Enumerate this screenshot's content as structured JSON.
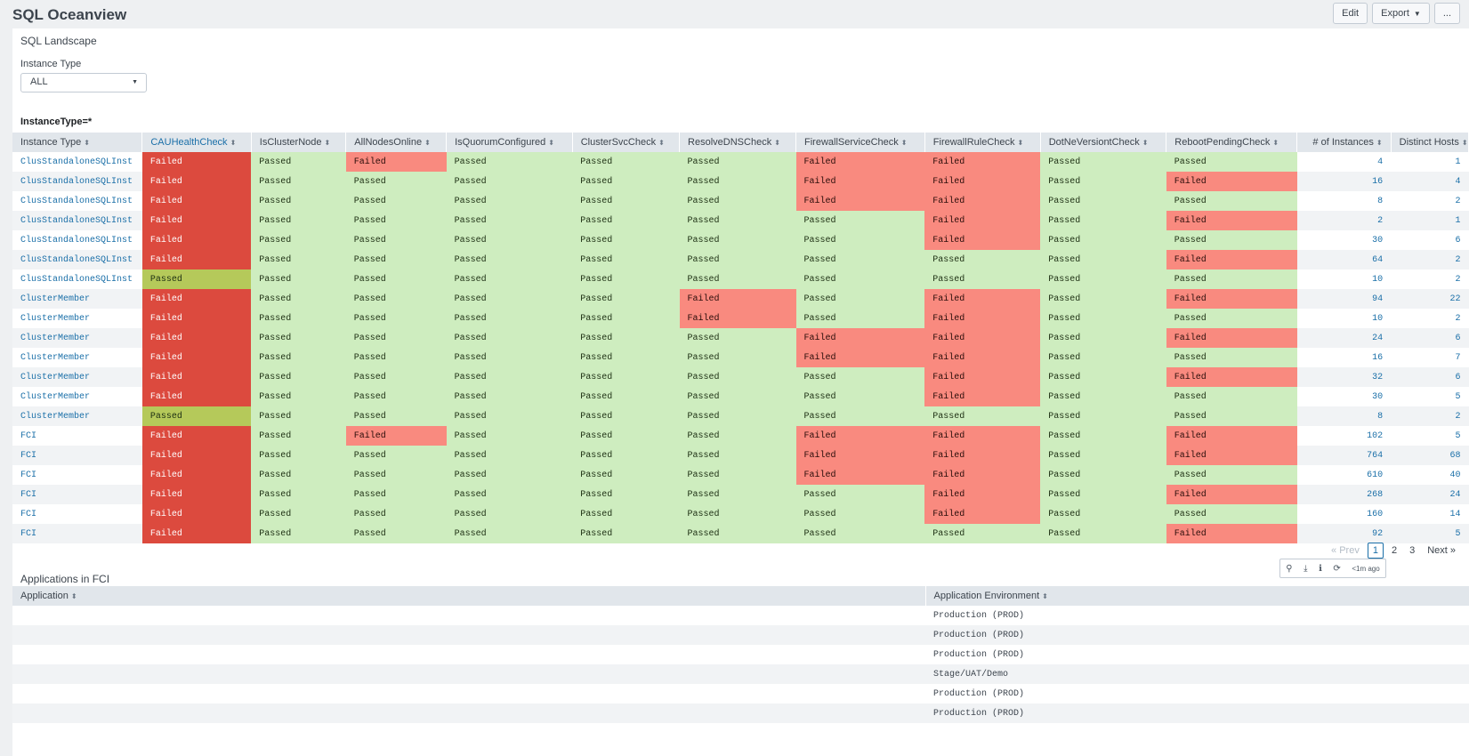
{
  "header": {
    "title": "SQL Oceanview",
    "edit_label": "Edit",
    "export_label": "Export",
    "more_label": "..."
  },
  "panel1": {
    "title": "SQL Landscape",
    "input_label": "Instance Type",
    "input_value": "ALL",
    "search_label": "InstanceType=*"
  },
  "main_table": {
    "columns": [
      "Instance Type",
      "CAUHealthCheck",
      "IsClusterNode",
      "AllNodesOnline",
      "IsQuorumConfigured",
      "ClusterSvcCheck",
      "ResolveDNSCheck",
      "FirewallServiceCheck",
      "FirewallRuleCheck",
      "DotNeVersiontCheck",
      "RebootPendingCheck",
      "# of Instances",
      "Distinct Hosts"
    ],
    "rows": [
      [
        "ClusStandaloneSQLInst",
        "Failed",
        "Passed",
        "Failed",
        "Passed",
        "Passed",
        "Passed",
        "Failed",
        "Failed",
        "Passed",
        "Passed",
        "4",
        "1"
      ],
      [
        "ClusStandaloneSQLInst",
        "Failed",
        "Passed",
        "Passed",
        "Passed",
        "Passed",
        "Passed",
        "Failed",
        "Failed",
        "Passed",
        "Failed",
        "16",
        "4"
      ],
      [
        "ClusStandaloneSQLInst",
        "Failed",
        "Passed",
        "Passed",
        "Passed",
        "Passed",
        "Passed",
        "Failed",
        "Failed",
        "Passed",
        "Passed",
        "8",
        "2"
      ],
      [
        "ClusStandaloneSQLInst",
        "Failed",
        "Passed",
        "Passed",
        "Passed",
        "Passed",
        "Passed",
        "Passed",
        "Failed",
        "Passed",
        "Failed",
        "2",
        "1"
      ],
      [
        "ClusStandaloneSQLInst",
        "Failed",
        "Passed",
        "Passed",
        "Passed",
        "Passed",
        "Passed",
        "Passed",
        "Failed",
        "Passed",
        "Passed",
        "30",
        "6"
      ],
      [
        "ClusStandaloneSQLInst",
        "Failed",
        "Passed",
        "Passed",
        "Passed",
        "Passed",
        "Passed",
        "Passed",
        "Passed",
        "Passed",
        "Failed",
        "64",
        "2"
      ],
      [
        "ClusStandaloneSQLInst",
        "Passed",
        "Passed",
        "Passed",
        "Passed",
        "Passed",
        "Passed",
        "Passed",
        "Passed",
        "Passed",
        "Passed",
        "10",
        "2"
      ],
      [
        "ClusterMember",
        "Failed",
        "Passed",
        "Passed",
        "Passed",
        "Passed",
        "Failed",
        "Passed",
        "Failed",
        "Passed",
        "Failed",
        "94",
        "22"
      ],
      [
        "ClusterMember",
        "Failed",
        "Passed",
        "Passed",
        "Passed",
        "Passed",
        "Failed",
        "Passed",
        "Failed",
        "Passed",
        "Passed",
        "10",
        "2"
      ],
      [
        "ClusterMember",
        "Failed",
        "Passed",
        "Passed",
        "Passed",
        "Passed",
        "Passed",
        "Failed",
        "Failed",
        "Passed",
        "Failed",
        "24",
        "6"
      ],
      [
        "ClusterMember",
        "Failed",
        "Passed",
        "Passed",
        "Passed",
        "Passed",
        "Passed",
        "Failed",
        "Failed",
        "Passed",
        "Passed",
        "16",
        "7"
      ],
      [
        "ClusterMember",
        "Failed",
        "Passed",
        "Passed",
        "Passed",
        "Passed",
        "Passed",
        "Passed",
        "Failed",
        "Passed",
        "Failed",
        "32",
        "6"
      ],
      [
        "ClusterMember",
        "Failed",
        "Passed",
        "Passed",
        "Passed",
        "Passed",
        "Passed",
        "Passed",
        "Failed",
        "Passed",
        "Passed",
        "30",
        "5"
      ],
      [
        "ClusterMember",
        "Passed",
        "Passed",
        "Passed",
        "Passed",
        "Passed",
        "Passed",
        "Passed",
        "Passed",
        "Passed",
        "Passed",
        "8",
        "2"
      ],
      [
        "FCI",
        "Failed",
        "Passed",
        "Failed",
        "Passed",
        "Passed",
        "Passed",
        "Failed",
        "Failed",
        "Passed",
        "Failed",
        "102",
        "5"
      ],
      [
        "FCI",
        "Failed",
        "Passed",
        "Passed",
        "Passed",
        "Passed",
        "Passed",
        "Failed",
        "Failed",
        "Passed",
        "Failed",
        "764",
        "68"
      ],
      [
        "FCI",
        "Failed",
        "Passed",
        "Passed",
        "Passed",
        "Passed",
        "Passed",
        "Failed",
        "Failed",
        "Passed",
        "Passed",
        "610",
        "40"
      ],
      [
        "FCI",
        "Failed",
        "Passed",
        "Passed",
        "Passed",
        "Passed",
        "Passed",
        "Passed",
        "Failed",
        "Passed",
        "Failed",
        "268",
        "24"
      ],
      [
        "FCI",
        "Failed",
        "Passed",
        "Passed",
        "Passed",
        "Passed",
        "Passed",
        "Passed",
        "Failed",
        "Passed",
        "Passed",
        "160",
        "14"
      ],
      [
        "FCI",
        "Failed",
        "Passed",
        "Passed",
        "Passed",
        "Passed",
        "Passed",
        "Passed",
        "Passed",
        "Passed",
        "Failed",
        "92",
        "5"
      ]
    ]
  },
  "pagination": {
    "prev": "« Prev",
    "pages": [
      "1",
      "2",
      "3"
    ],
    "current": "1",
    "next": "Next »"
  },
  "panel_tools": {
    "icons": [
      "search-icon",
      "download-icon",
      "info-icon",
      "refresh-icon"
    ],
    "last_updated": "<1m ago"
  },
  "panel2": {
    "title": "Applications in FCI",
    "columns": [
      "Application",
      "Application Environment"
    ],
    "rows": [
      [
        "",
        "Production (PROD)"
      ],
      [
        "",
        "Production (PROD)"
      ],
      [
        "",
        "Production (PROD)"
      ],
      [
        "",
        "Stage/UAT/Demo"
      ],
      [
        "",
        "Production (PROD)"
      ],
      [
        "",
        "Production (PROD)"
      ]
    ]
  },
  "colors": {
    "passed": "#ceedbf",
    "failed": "#f98a7f",
    "cau_failed": "#dc4a3e",
    "cau_passed": "#b5c95a",
    "link": "#1a6fa8",
    "header_bg": "#e1e6eb"
  }
}
